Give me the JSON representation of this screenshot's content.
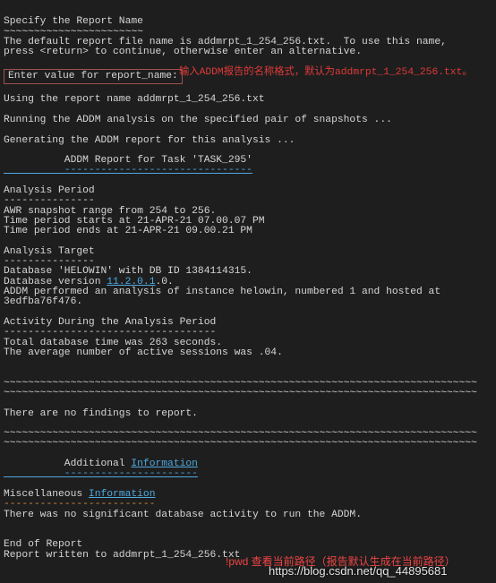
{
  "header": {
    "title": "Specify the Report Name",
    "rule": "~~~~~~~~~~~~~~~~~~~~~~~",
    "desc1": "The default report file name is addmrpt_1_254_256.txt.  To use this name,",
    "desc2": "press <return> to continue, otherwise enter an alternative."
  },
  "prompt": {
    "label": "Enter value for report_name:",
    "note": "输入ADDM报告的名称格式，默认为addmrpt_1_254_256.txt。"
  },
  "body": {
    "l1": "Using the report name addmrpt_1_254_256.txt",
    "l2": "Running the ADDM analysis on the specified pair of snapshots ...",
    "l3": "Generating the ADDM report for this analysis ...",
    "task_title": "          ADDM Report for Task 'TASK_295'",
    "task_rule": "          -------------------------------",
    "ap_title": "Analysis Period",
    "ap_rule": "---------------",
    "ap1": "AWR snapshot range from 254 to 256.",
    "ap2": "Time period starts at 21-APR-21 07.00.07 PM",
    "ap3": "Time period ends at 21-APR-21 09.00.21 PM",
    "at_title": "Analysis Target",
    "at_rule": "---------------",
    "at1": "Database 'HELOWIN' with DB ID 1384114315.",
    "at2_pre": "Database version ",
    "at2_link": "11.2.0.1",
    "at2_post": ".0.",
    "at3": "ADDM performed an analysis of instance helowin, numbered 1 and hosted at",
    "at4": "3edfba76f476.",
    "act_title": "Activity During the Analysis Period",
    "act_rule": "-----------------------------------",
    "act1": "Total database time was 263 seconds.",
    "act2": "The average number of active sessions was .04.",
    "tilde": "~~~~~~~~~~~~~~~~~~~~~~~~~~~~~~~~~~~~~~~~~~~~~~~~~~~~~~~~~~~~~~~~~~~~~~~~~~~~~~",
    "nofind": "There are no findings to report.",
    "add_pre": "          Additional ",
    "add_link": "Information",
    "add_rule": "          ----------------------",
    "misc_pre": "Miscellaneous ",
    "misc_link": "Information",
    "misc_rule": "-------------------------",
    "misc1": "There was no significant database activity to run the ADDM.",
    "end1": "End of Report",
    "end2": "Report written to addmrpt_1_254_256.txt"
  },
  "overlay": {
    "red_wm": "!pwd 查看当前路径（报告默认生成在当前路径）",
    "url_wm": "https://blog.csdn.net/qq_44895681"
  }
}
